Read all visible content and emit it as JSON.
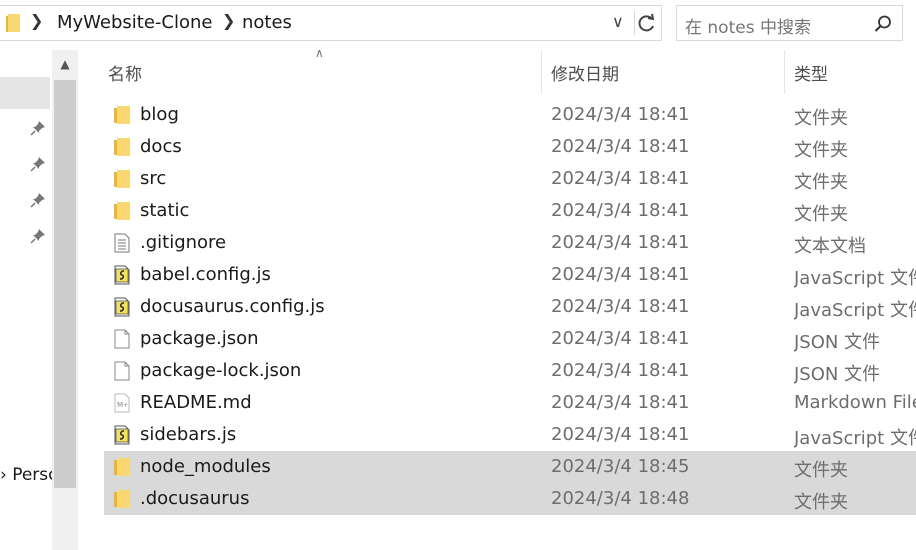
{
  "address_bar": {
    "crumbs": [
      "MyWebsite-Clone",
      "notes"
    ],
    "search_placeholder": "在 notes 中搜索"
  },
  "nav": {
    "partial_item_label": "Persc"
  },
  "columns": {
    "name": "名称",
    "date_modified": "修改日期",
    "type": "类型"
  },
  "files": [
    {
      "name": "blog",
      "date": "2024/3/4 18:41",
      "type": "文件夹",
      "icon": "folder-icon"
    },
    {
      "name": "docs",
      "date": "2024/3/4 18:41",
      "type": "文件夹",
      "icon": "folder-icon"
    },
    {
      "name": "src",
      "date": "2024/3/4 18:41",
      "type": "文件夹",
      "icon": "folder-icon"
    },
    {
      "name": "static",
      "date": "2024/3/4 18:41",
      "type": "文件夹",
      "icon": "folder-icon"
    },
    {
      "name": ".gitignore",
      "date": "2024/3/4 18:41",
      "type": "文本文档",
      "icon": "text-file-icon"
    },
    {
      "name": "babel.config.js",
      "date": "2024/3/4 18:41",
      "type": "JavaScript 文件",
      "icon": "js-file-icon"
    },
    {
      "name": "docusaurus.config.js",
      "date": "2024/3/4 18:41",
      "type": "JavaScript 文件",
      "icon": "js-file-icon"
    },
    {
      "name": "package.json",
      "date": "2024/3/4 18:41",
      "type": "JSON 文件",
      "icon": "blank-file-icon"
    },
    {
      "name": "package-lock.json",
      "date": "2024/3/4 18:41",
      "type": "JSON 文件",
      "icon": "blank-file-icon"
    },
    {
      "name": "README.md",
      "date": "2024/3/4 18:41",
      "type": "Markdown File",
      "icon": "markdown-file-icon"
    },
    {
      "name": "sidebars.js",
      "date": "2024/3/4 18:41",
      "type": "JavaScript 文件",
      "icon": "js-file-icon"
    },
    {
      "name": "node_modules",
      "date": "2024/3/4 18:45",
      "type": "文件夹",
      "icon": "folder-icon",
      "selected": true
    },
    {
      "name": ".docusaurus",
      "date": "2024/3/4 18:48",
      "type": "文件夹",
      "icon": "folder-icon",
      "selected": true
    }
  ],
  "colors": {
    "selection": "#d9d9d9",
    "folder": "#f8d775",
    "secondary_text": "#6d6d6d"
  }
}
